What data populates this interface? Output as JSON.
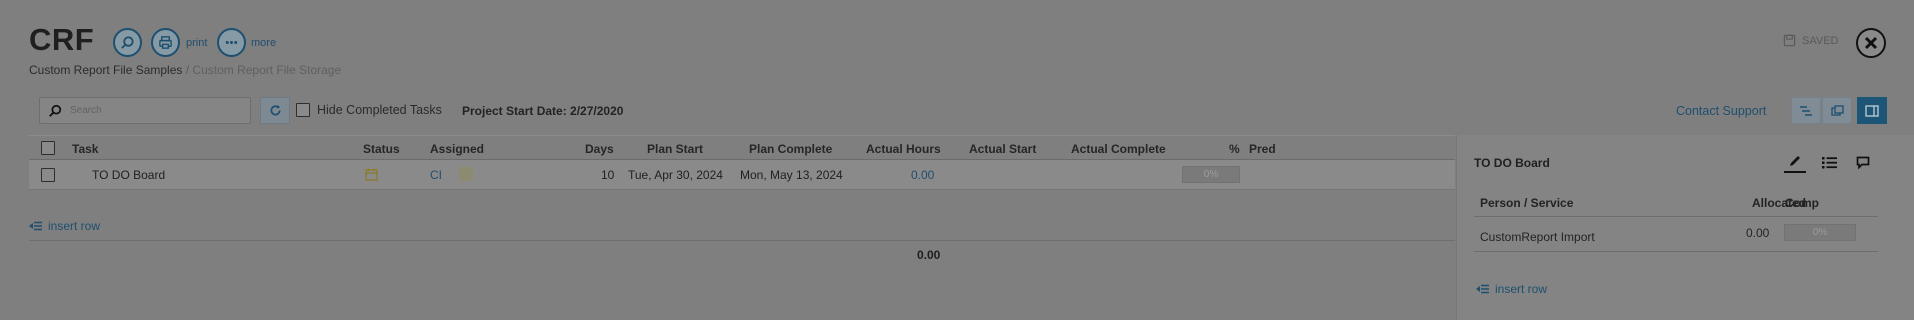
{
  "header": {
    "title": "CRF",
    "buttons": [
      {
        "icon": "search-icon",
        "label": ""
      },
      {
        "icon": "print-icon",
        "label": "print"
      },
      {
        "icon": "more-icon",
        "label": "more"
      }
    ],
    "breadcrumb": {
      "parent": "Custom Report File Samples",
      "separator": " / ",
      "current": "Custom Report File Storage"
    },
    "saved_label": "SAVED"
  },
  "toolbar": {
    "search_placeholder": "Search",
    "hide_completed_label": "Hide Completed Tasks",
    "hide_completed_checked": false,
    "project_start": "Project Start Date: 2/27/2020",
    "contact_support": "Contact Support",
    "view_buttons": [
      "gantt-view-icon",
      "copy-view-icon",
      "side-panel-view-icon"
    ]
  },
  "table": {
    "columns": [
      "Task",
      "Status",
      "Assigned",
      "Days",
      "Plan Start",
      "Plan Complete",
      "Actual Hours",
      "Actual Start",
      "Actual Complete",
      "%",
      "Pred"
    ],
    "rows": [
      {
        "task": "TO DO Board",
        "status_icon": "calendar-icon",
        "assigned": "CI",
        "days": "10",
        "plan_start": "Tue, Apr 30, 2024",
        "plan_complete": "Mon, May 13, 2024",
        "actual_hours": "0.00",
        "actual_start": "",
        "actual_complete": "",
        "percent": "0%",
        "pred": ""
      }
    ],
    "insert_row_label": "insert row",
    "total_actual_hours": "0.00"
  },
  "side_panel": {
    "title": "TO DO Board",
    "tabs": [
      "edit-icon",
      "list-icon",
      "comment-icon"
    ],
    "columns": [
      "Person / Service",
      "Allocated",
      "Comp"
    ],
    "rows": [
      {
        "person": "CustomReport Import",
        "allocated": "0.00",
        "comp": "0%"
      }
    ],
    "insert_row_label": "insert row"
  },
  "colors": {
    "accent": "#1e4f6e",
    "overlay_background": "#7f7f7f"
  }
}
